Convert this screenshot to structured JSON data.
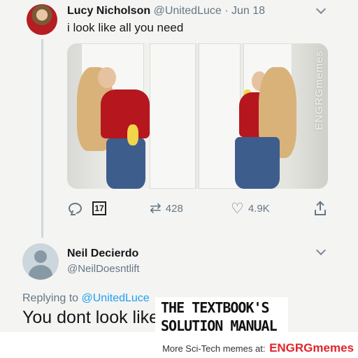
{
  "tweet1": {
    "name": "Lucy Nicholson",
    "handle": "@UnitedLuce",
    "separator": "·",
    "date": "Jun 18",
    "text": "i look like all you need",
    "watermark": "ENGRGmemes",
    "actions": {
      "retweets": "428",
      "likes": "4.9K",
      "emoji_label": "17"
    }
  },
  "tweet2": {
    "name": "Neil Decierdo",
    "handle": "@NeilDoesntlift",
    "replying_prefix": "Replying to",
    "replying_mention": "@UnitedLuce",
    "text": "You dont look like"
  },
  "overlay": {
    "line1": "THE TEXTBOOK'S",
    "line2": "SOLUTION MANUAL"
  },
  "footer": {
    "prefix": "More Sci-Tech memes at:",
    "brand": "ENGRGmemes"
  },
  "colors": {
    "link": "#1da1f2",
    "muted": "#657786",
    "brand_red": "#e0242c"
  },
  "icons": [
    "reply-icon",
    "emoji-icon",
    "retweet-icon",
    "like-icon",
    "share-icon",
    "chevron-down-icon"
  ]
}
